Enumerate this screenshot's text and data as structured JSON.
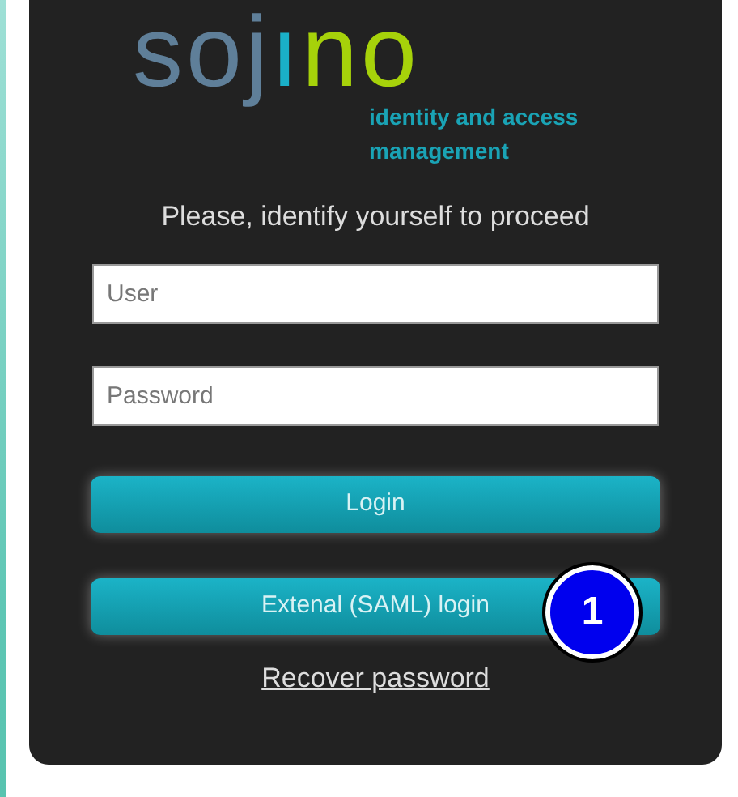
{
  "logo": {
    "parts": [
      {
        "text": "soj",
        "color": "#5f7f99"
      },
      {
        "text": "ı",
        "color": "#1ab0c8"
      },
      {
        "text": "no",
        "color": "#a6d20a"
      }
    ],
    "tagline": "identity and access management"
  },
  "prompt": "Please, identify yourself to proceed",
  "fields": [
    {
      "placeholder": "User"
    },
    {
      "placeholder": "Password"
    }
  ],
  "buttons": [
    {
      "label": "Login"
    },
    {
      "label": "Extenal (SAML) login"
    }
  ],
  "link": "Recover password",
  "callout": "1"
}
